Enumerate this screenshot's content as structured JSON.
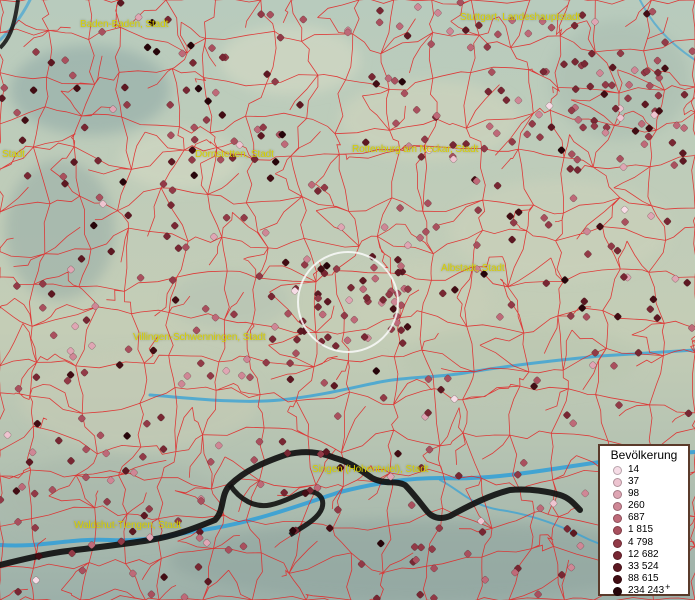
{
  "map": {
    "place_labels": [
      {
        "name": "Baden-Baden, Stadt"
      },
      {
        "name": "Stuttgart, Landeshauptstadt"
      },
      {
        "name": "Stadt"
      },
      {
        "name": "Dornstetten, Stadt"
      },
      {
        "name": "Rottenburg am Neckar, Stadt"
      },
      {
        "name": "Albstadt, Stadt"
      },
      {
        "name": "Villingen-Schwenningen, Stadt"
      },
      {
        "name": "Singen (Hohentwiel), Stadt"
      },
      {
        "name": "Waldshut-Tiengen, Stadt"
      }
    ],
    "colors": {
      "boundary": "#e02a2a",
      "national_border": "#111111",
      "river": "#2f9fd8",
      "label": "#d8d000",
      "legend_frame": "#5a3a2a"
    }
  },
  "legend": {
    "title": "Bevölkerung",
    "items": [
      {
        "label": "14",
        "color": "#f6dce6"
      },
      {
        "label": "37",
        "color": "#edc4d0"
      },
      {
        "label": "98",
        "color": "#dfa6b4"
      },
      {
        "label": "260",
        "color": "#cf8796"
      },
      {
        "label": "687",
        "color": "#be6a79"
      },
      {
        "label": "1 815",
        "color": "#a9505e"
      },
      {
        "label": "4 798",
        "color": "#923a47"
      },
      {
        "label": "12 682",
        "color": "#782733"
      },
      {
        "label": "33 524",
        "color": "#5d1822"
      },
      {
        "label": "88 615",
        "color": "#420d14"
      },
      {
        "label": "234 243",
        "color": "#26050a",
        "suffix": "+"
      }
    ]
  }
}
